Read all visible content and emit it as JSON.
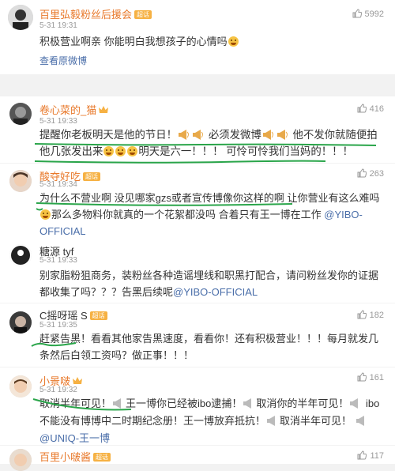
{
  "post": {
    "author": "百里弘毅粉丝后援会",
    "badge": "超话",
    "time": "5-31 19:31",
    "likes": "5992",
    "text": "积极营业啊亲 你能明白我想孩子的心情吗",
    "view_original": "查看原微博"
  },
  "comments": [
    {
      "author": "卷心菜的_猫",
      "likes": "416",
      "time": "5-31 19:33",
      "text_a": "提醒你老板明天是他的节日！",
      "text_b": "必须发微博",
      "text_c": "他不发你就随便拍他几张发出来",
      "text_d": "明天是六一！！！ 可怜可怜我们当妈的！！！"
    },
    {
      "author": "酸夺好吃",
      "badge": "超话",
      "likes": "263",
      "time": "5-31 19:34",
      "text_a": "为什么不营业啊 没见哪家gzs或者宣传博像你这样的啊 让你营业有这么难吗",
      "text_b": "那么多物料你就真的一个花絮都没吗 合着只有王一博在工作",
      "mention": "@YIBO-OFFICIAL"
    },
    {
      "author": "糖源 tyf",
      "time": "5-31 19:33",
      "text": "别家脂粉狙商务，装粉丝各种造谣埋线和职黑打配合，请问粉丝发你的证据都收集了吗？？？告黑后续呢",
      "mention": "@YIBO-OFFICIAL"
    },
    {
      "author": "C摇呀瑶 S",
      "badge": "超话",
      "likes": "182",
      "time": "5-31 19:35",
      "text": "赶紧告黑！看看其他家告黑速度，看看你！还有积极营业！！！每月就发几条然后白领工资吗？做正事！！！"
    },
    {
      "author": "小景啵",
      "likes": "161",
      "time": "5-31 19:32",
      "text_a": "取消半年可见！",
      "text_b": "王一博你已经被ibo逮捕！",
      "text_c": "取消你的半年可见！",
      "text_d": "ibo不能没有博博中二时期纪念册！王一博放弃抵抗！",
      "text_e": "取消半年可见！",
      "mention": "@UNIQ-王一博"
    },
    {
      "author": "百里小啵酱",
      "badge": "超话",
      "likes": "117"
    }
  ],
  "colors": {
    "name": "#e8782a",
    "link": "#4a6ea9",
    "highlight": "#2aa54a",
    "badge": "#f6b143"
  }
}
